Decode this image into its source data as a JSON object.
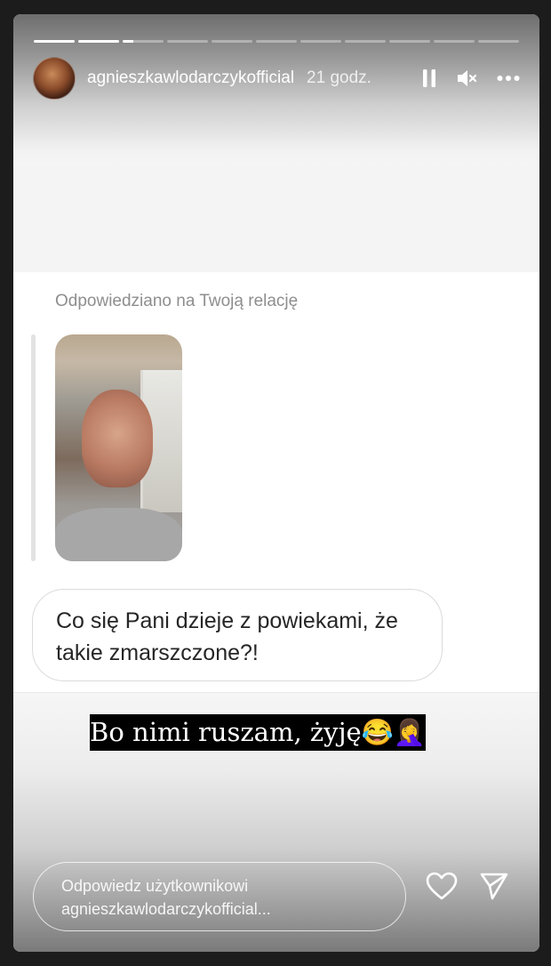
{
  "header": {
    "username": "agnieszkawlodarczykofficial",
    "time": "21 godz."
  },
  "progress": {
    "segments": 11,
    "current_index": 2,
    "current_fraction": 0.25
  },
  "reply_card": {
    "label": "Odpowiedziano na Twoją relację",
    "message": "Co się Pani dzieje z powiekami, że takie zmarszczone?!"
  },
  "caption": {
    "text": "Bo nimi ruszam, żyję😂🤦‍♀️"
  },
  "reply_input": {
    "placeholder_line1": "Odpowiedz użytkownikowi",
    "placeholder_line2": "agnieszkawlodarczykofficial..."
  },
  "icons": {
    "pause": "pause-icon",
    "mute": "speaker-muted-icon",
    "more": "more-dots-icon",
    "like": "heart-icon",
    "send": "send-icon"
  }
}
